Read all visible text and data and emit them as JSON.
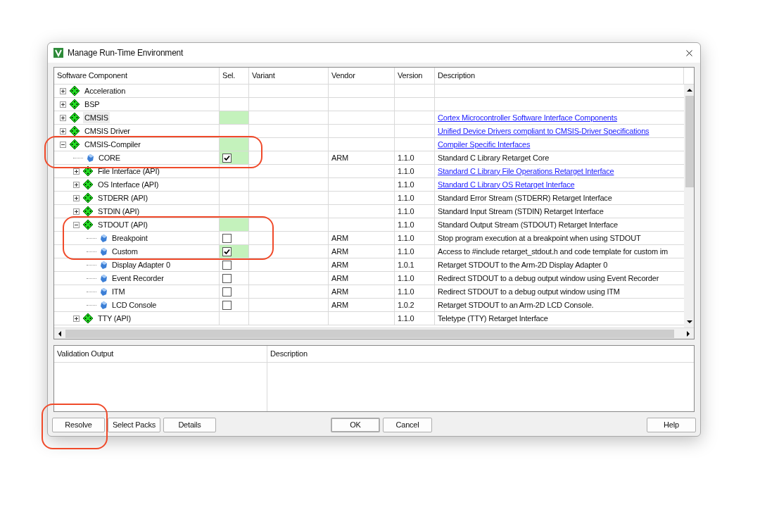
{
  "window": {
    "title": "Manage Run-Time Environment"
  },
  "table": {
    "columns": [
      "Software Component",
      "Sel.",
      "Variant",
      "Vendor",
      "Version",
      "Description"
    ],
    "tree": [
      {
        "label": "Acceleration",
        "kind": "group",
        "expanded": false,
        "selected": false,
        "active": false
      },
      {
        "label": "BSP",
        "kind": "group",
        "expanded": false,
        "selected": false,
        "active": false
      },
      {
        "label": "CMSIS",
        "kind": "group",
        "expanded": false,
        "selected": true,
        "active": true,
        "description": "Cortex Microcontroller Software Interface Components",
        "link": true
      },
      {
        "label": "CMSIS Driver",
        "kind": "group",
        "expanded": false,
        "selected": false,
        "active": false,
        "description": "Unified Device Drivers compliant to CMSIS-Driver Specifications",
        "link": true
      },
      {
        "label": "CMSIS-Compiler",
        "kind": "group",
        "expanded": true,
        "selected": false,
        "active": true,
        "description": "Compiler Specific Interfaces",
        "link": true,
        "children": [
          {
            "label": "CORE",
            "kind": "component",
            "checked": true,
            "selected": false,
            "active": true,
            "vendor": "ARM",
            "version": "1.1.0",
            "description": "Standard C Library Retarget Core",
            "link": false
          },
          {
            "label": "File Interface (API)",
            "kind": "group",
            "expanded": false,
            "selected": false,
            "active": false,
            "version": "1.1.0",
            "description": "Standard C Library File Operations Retarget Interface",
            "link": true
          },
          {
            "label": "OS Interface (API)",
            "kind": "group",
            "expanded": false,
            "selected": false,
            "active": false,
            "version": "1.1.0",
            "description": "Standard C Library OS Retarget Interface",
            "link": true
          },
          {
            "label": "STDERR (API)",
            "kind": "group",
            "expanded": false,
            "selected": false,
            "active": false,
            "version": "1.1.0",
            "description": "Standard Error Stream (STDERR) Retarget Interface",
            "link": false
          },
          {
            "label": "STDIN (API)",
            "kind": "group",
            "expanded": false,
            "selected": false,
            "active": false,
            "version": "1.1.0",
            "description": "Standard Input Stream (STDIN) Retarget Interface",
            "link": false
          },
          {
            "label": "STDOUT (API)",
            "kind": "group",
            "expanded": true,
            "selected": false,
            "active": true,
            "version": "1.1.0",
            "description": "Standard Output Stream (STDOUT) Retarget Interface",
            "link": false,
            "children": [
              {
                "label": "Breakpoint",
                "kind": "component",
                "checked": false,
                "selected": false,
                "active": false,
                "vendor": "ARM",
                "version": "1.1.0",
                "description": "Stop program execution at a breakpoint when using STDOUT",
                "link": false
              },
              {
                "label": "Custom",
                "kind": "component",
                "checked": true,
                "selected": false,
                "active": true,
                "vendor": "ARM",
                "version": "1.1.0",
                "description": "Access to #include retarget_stdout.h and code template for custom im",
                "link": false
              },
              {
                "label": "Display Adapter 0",
                "kind": "component",
                "checked": false,
                "selected": false,
                "active": false,
                "vendor": "ARM",
                "version": "1.0.1",
                "description": "Retarget STDOUT to the Arm-2D Display Adapter 0",
                "link": false
              },
              {
                "label": "Event Recorder",
                "kind": "component",
                "checked": false,
                "selected": false,
                "active": false,
                "vendor": "ARM",
                "version": "1.1.0",
                "description": "Redirect STDOUT to a debug output window using Event Recorder",
                "link": false
              },
              {
                "label": "ITM",
                "kind": "component",
                "checked": false,
                "selected": false,
                "active": false,
                "vendor": "ARM",
                "version": "1.1.0",
                "description": "Redirect STDOUT to a debug output window using ITM",
                "link": false
              },
              {
                "label": "LCD Console",
                "kind": "component",
                "checked": false,
                "selected": false,
                "active": false,
                "vendor": "ARM",
                "version": "1.0.2",
                "description": "Retarget STDOUT to an Arm-2D LCD Console.",
                "link": false
              }
            ]
          },
          {
            "label": "TTY (API)",
            "kind": "group",
            "expanded": false,
            "selected": false,
            "active": false,
            "version": "1.1.0",
            "description": "Teletype (TTY) Retarget Interface",
            "link": false
          }
        ]
      }
    ]
  },
  "validation": {
    "columns": [
      "Validation Output",
      "Description"
    ]
  },
  "buttons": [
    {
      "label": "Resolve",
      "kind": "left"
    },
    {
      "label": "Select Packs",
      "kind": "left"
    },
    {
      "label": "Details",
      "kind": "left"
    },
    {
      "label": "OK",
      "kind": "default"
    },
    {
      "label": "Cancel",
      "kind": "center"
    },
    {
      "label": "Help",
      "kind": "right"
    }
  ]
}
